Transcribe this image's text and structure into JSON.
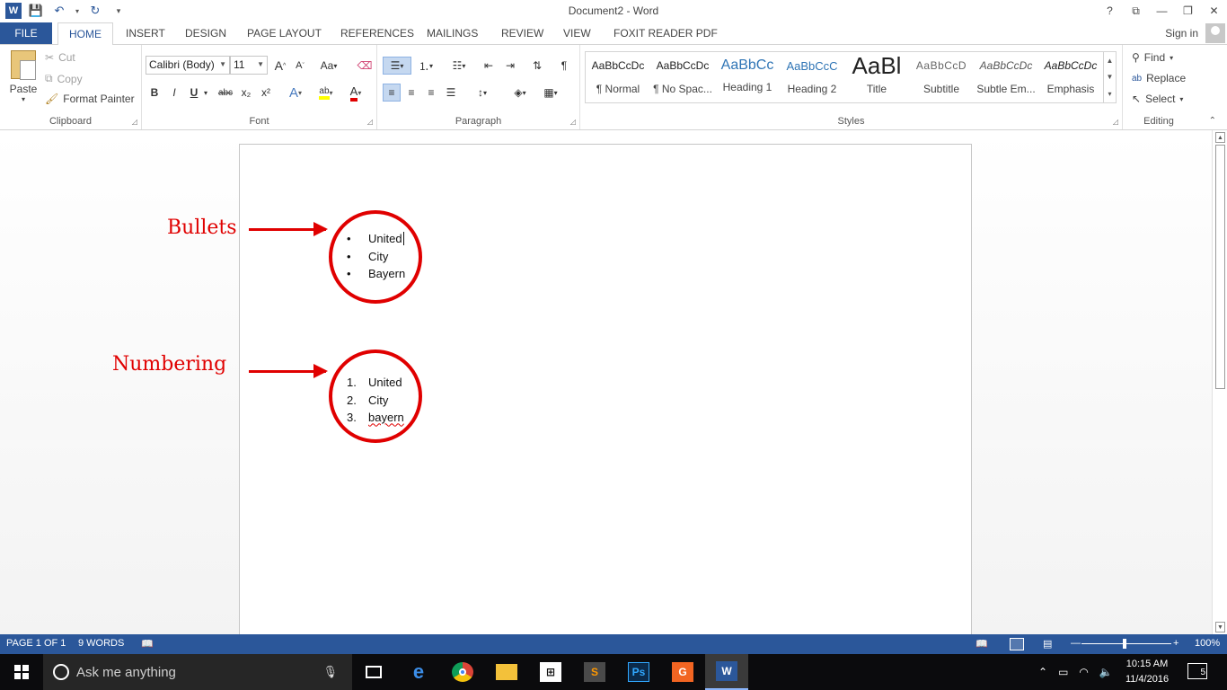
{
  "window": {
    "title": "Document2 - Word",
    "help": "?",
    "controls": [
      "⧉",
      "—",
      "🗗",
      "✕"
    ]
  },
  "tabs": {
    "file": "FILE",
    "items": [
      "HOME",
      "INSERT",
      "DESIGN",
      "PAGE LAYOUT",
      "REFERENCES",
      "MAILINGS",
      "REVIEW",
      "VIEW",
      "FOXIT READER PDF"
    ],
    "active": "HOME",
    "signin": "Sign in"
  },
  "ribbon": {
    "clipboard": {
      "label": "Clipboard",
      "paste": "Paste",
      "cut": "Cut",
      "copy": "Copy",
      "format_painter": "Format Painter"
    },
    "font": {
      "label": "Font",
      "font_name": "Calibri (Body)",
      "font_size": "11",
      "grow": "A",
      "shrink": "A",
      "change_case": "Aa",
      "bold": "B",
      "italic": "I",
      "underline": "U",
      "strike": "abc",
      "subscript": "x₂",
      "superscript": "x²",
      "text_effects": "A",
      "highlight": "ab",
      "font_color": "A"
    },
    "paragraph": {
      "label": "Paragraph"
    },
    "styles": {
      "label": "Styles",
      "items": [
        {
          "preview": "AaBbCcDc",
          "name": "¶ Normal"
        },
        {
          "preview": "AaBbCcDc",
          "name": "¶ No Spac..."
        },
        {
          "preview": "AaBbCc",
          "name": "Heading 1"
        },
        {
          "preview": "AaBbCcC",
          "name": "Heading 2"
        },
        {
          "preview": "AaBl",
          "name": "Title"
        },
        {
          "preview": "AaBbCcD",
          "name": "Subtitle"
        },
        {
          "preview": "AaBbCcDc",
          "name": "Subtle Em..."
        },
        {
          "preview": "AaBbCcDc",
          "name": "Emphasis"
        }
      ]
    },
    "editing": {
      "label": "Editing",
      "find": "Find",
      "replace": "Replace",
      "select": "Select"
    }
  },
  "document": {
    "bullets_label": "Bullets",
    "numbering_label": "Numbering",
    "bullet_items": [
      "United",
      "City",
      "Bayern"
    ],
    "numbered_items": [
      {
        "num": "1.",
        "text": "United"
      },
      {
        "num": "2.",
        "text": "City"
      },
      {
        "num": "3.",
        "text": "bayern"
      }
    ]
  },
  "statusbar": {
    "page": "PAGE 1 OF 1",
    "words": "9 WORDS",
    "zoom": "100%"
  },
  "taskbar": {
    "search_placeholder": "Ask me anything",
    "time": "10:15 AM",
    "date": "11/4/2016",
    "notifications": "5"
  },
  "colors": {
    "accent": "#2b579a",
    "annotation": "#e00000"
  }
}
